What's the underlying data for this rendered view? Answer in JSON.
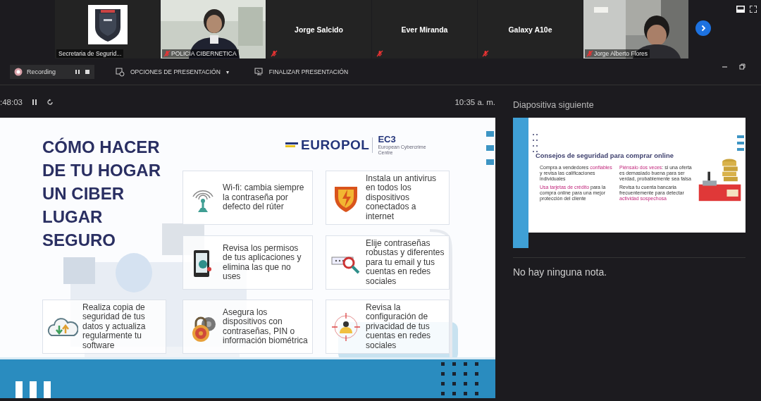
{
  "participants": [
    {
      "kind": "logo",
      "name": "Secretaria de Segurid...",
      "muted": false
    },
    {
      "kind": "video",
      "name": "POLICIA CIBERNETICA",
      "muted": true
    },
    {
      "kind": "name",
      "name": "Jorge Salcido",
      "muted": true
    },
    {
      "kind": "name",
      "name": "Ever Miranda",
      "muted": true
    },
    {
      "kind": "name",
      "name": "Galaxy A10e",
      "muted": true
    },
    {
      "kind": "video",
      "name": "Jorge Alberto Flores",
      "muted": true
    }
  ],
  "recording": {
    "label": "Recording"
  },
  "toolbar": [
    {
      "label": "OPCIONES DE PRESENTACIÓN",
      "caret": "▾"
    },
    {
      "label": "FINALIZAR PRESENTACIÓN"
    }
  ],
  "timer": ":48:03",
  "clock": "10:35 a. m.",
  "slide": {
    "title_lines": [
      "CÓMO HACER",
      "DE TU HOGAR",
      "UN CIBER",
      "LUGAR",
      "SEGURO"
    ],
    "logo": {
      "name": "EUROPOL",
      "unit": "EC3",
      "unit_caption": "European Cybercrime Centre"
    },
    "cards": [
      {
        "text": "Wi-fi: cambia siempre la contraseña por defecto del rúter"
      },
      {
        "text": "Instala un antivirus en todos los dispositivos conectados a internet"
      },
      {
        "text": "Revisa los permisos de tus aplicaciones y elimina las que no uses"
      },
      {
        "text": "Elije contraseñas robustas y diferentes para tu email y tus cuentas en redes sociales"
      },
      {
        "text": "Realiza copia de seguridad de tus datos y actualiza regularmente tu software"
      },
      {
        "text": "Asegura los dispositivos con contraseñas, PIN o información biométrica"
      },
      {
        "text": "Revisa la configuración de privacidad de tus cuentas en redes sociales"
      }
    ]
  },
  "next_slide": {
    "label": "Diapositiva siguiente",
    "title": "Consejos de seguridad para comprar online",
    "tips": [
      {
        "parts": [
          {
            "text": "Compra a vendedores ",
            "highlight": false
          },
          {
            "text": "confiables",
            "highlight": true
          },
          {
            "text": " y revisa las calificaciones individuales",
            "highlight": false
          }
        ]
      },
      {
        "parts": [
          {
            "text": "Piénsalo dos veces",
            "highlight": true
          },
          {
            "text": ": si una oferta es demasiado buena para ser verdad, probablemente sea falsa",
            "highlight": false
          }
        ]
      },
      {
        "parts": [
          {
            "text": "Usa tarjetas de crédito",
            "highlight": true
          },
          {
            "text": " para la compra online para una mejor protección del cliente",
            "highlight": false
          }
        ]
      },
      {
        "parts": [
          {
            "text": "Revisa tu cuenta bancaria frecuentemente para detectar ",
            "highlight": false
          },
          {
            "text": "actividad sospechosa",
            "highlight": true
          }
        ]
      }
    ]
  },
  "notes": "No hay ninguna nota."
}
